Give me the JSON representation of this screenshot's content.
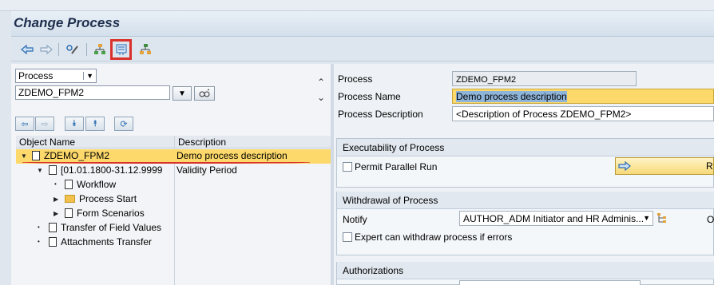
{
  "window": {
    "title": "Change Process"
  },
  "colors": {
    "highlight": "#fdd96b",
    "accent": "#d9312b",
    "icon_blue": "#2b6bb0"
  },
  "toolbar": {
    "buttons": [
      {
        "name": "back-arrow-icon",
        "glyph": "⇦"
      },
      {
        "name": "forward-arrow-icon",
        "glyph": "⇨"
      },
      {
        "name": "display-change-icon",
        "glyph": "✎"
      },
      {
        "name": "hierarchy-icon",
        "glyph": "⛬"
      },
      {
        "name": "field-mapping-icon",
        "glyph": "▤"
      },
      {
        "name": "org-structure-icon",
        "glyph": "⛊"
      }
    ]
  },
  "left": {
    "object_type": "Process",
    "object_value": "ZDEMO_FPM2",
    "tree_header": {
      "col1": "Object Name",
      "col2": "Description"
    },
    "tree": [
      {
        "label": "ZDEMO_FPM2",
        "desc": "Demo process description",
        "icon": "doc",
        "expand": "▼",
        "indent": 0
      },
      {
        "label": "[01.01.1800-31.12.9999",
        "desc": "Validity Period",
        "icon": "doc",
        "expand": "▼",
        "indent": 1
      },
      {
        "label": "Workflow",
        "desc": "",
        "icon": "doc",
        "expand": "•",
        "indent": 2
      },
      {
        "label": "Process Start",
        "desc": "",
        "icon": "folder",
        "expand": "▶",
        "indent": 2
      },
      {
        "label": "Form Scenarios",
        "desc": "",
        "icon": "doc",
        "expand": "▶",
        "indent": 2
      },
      {
        "label": "Transfer of Field Values",
        "desc": "",
        "icon": "doc",
        "expand": "•",
        "indent": 1
      },
      {
        "label": "Attachments Transfer",
        "desc": "",
        "icon": "doc",
        "expand": "•",
        "indent": 1
      }
    ]
  },
  "right": {
    "process_label": "Process",
    "process_value": "ZDEMO_FPM2",
    "name_label": "Process Name",
    "name_value": "Demo process description",
    "desc_label": "Process Description",
    "desc_value": "<Description of Process ZDEMO_FPM2>",
    "exec_group": {
      "title": "Executability of Process",
      "parallel_label": "Permit Parallel Run",
      "button_label": "R"
    },
    "withdraw_group": {
      "title": "Withdrawal of Process",
      "notify_label": "Notify",
      "notify_value": "AUTHOR_ADM Initiator and HR Adminis...",
      "expert_label": "Expert can withdraw process if errors",
      "trailing_label": "O"
    },
    "auth_group": {
      "title": "Authorizations"
    }
  }
}
